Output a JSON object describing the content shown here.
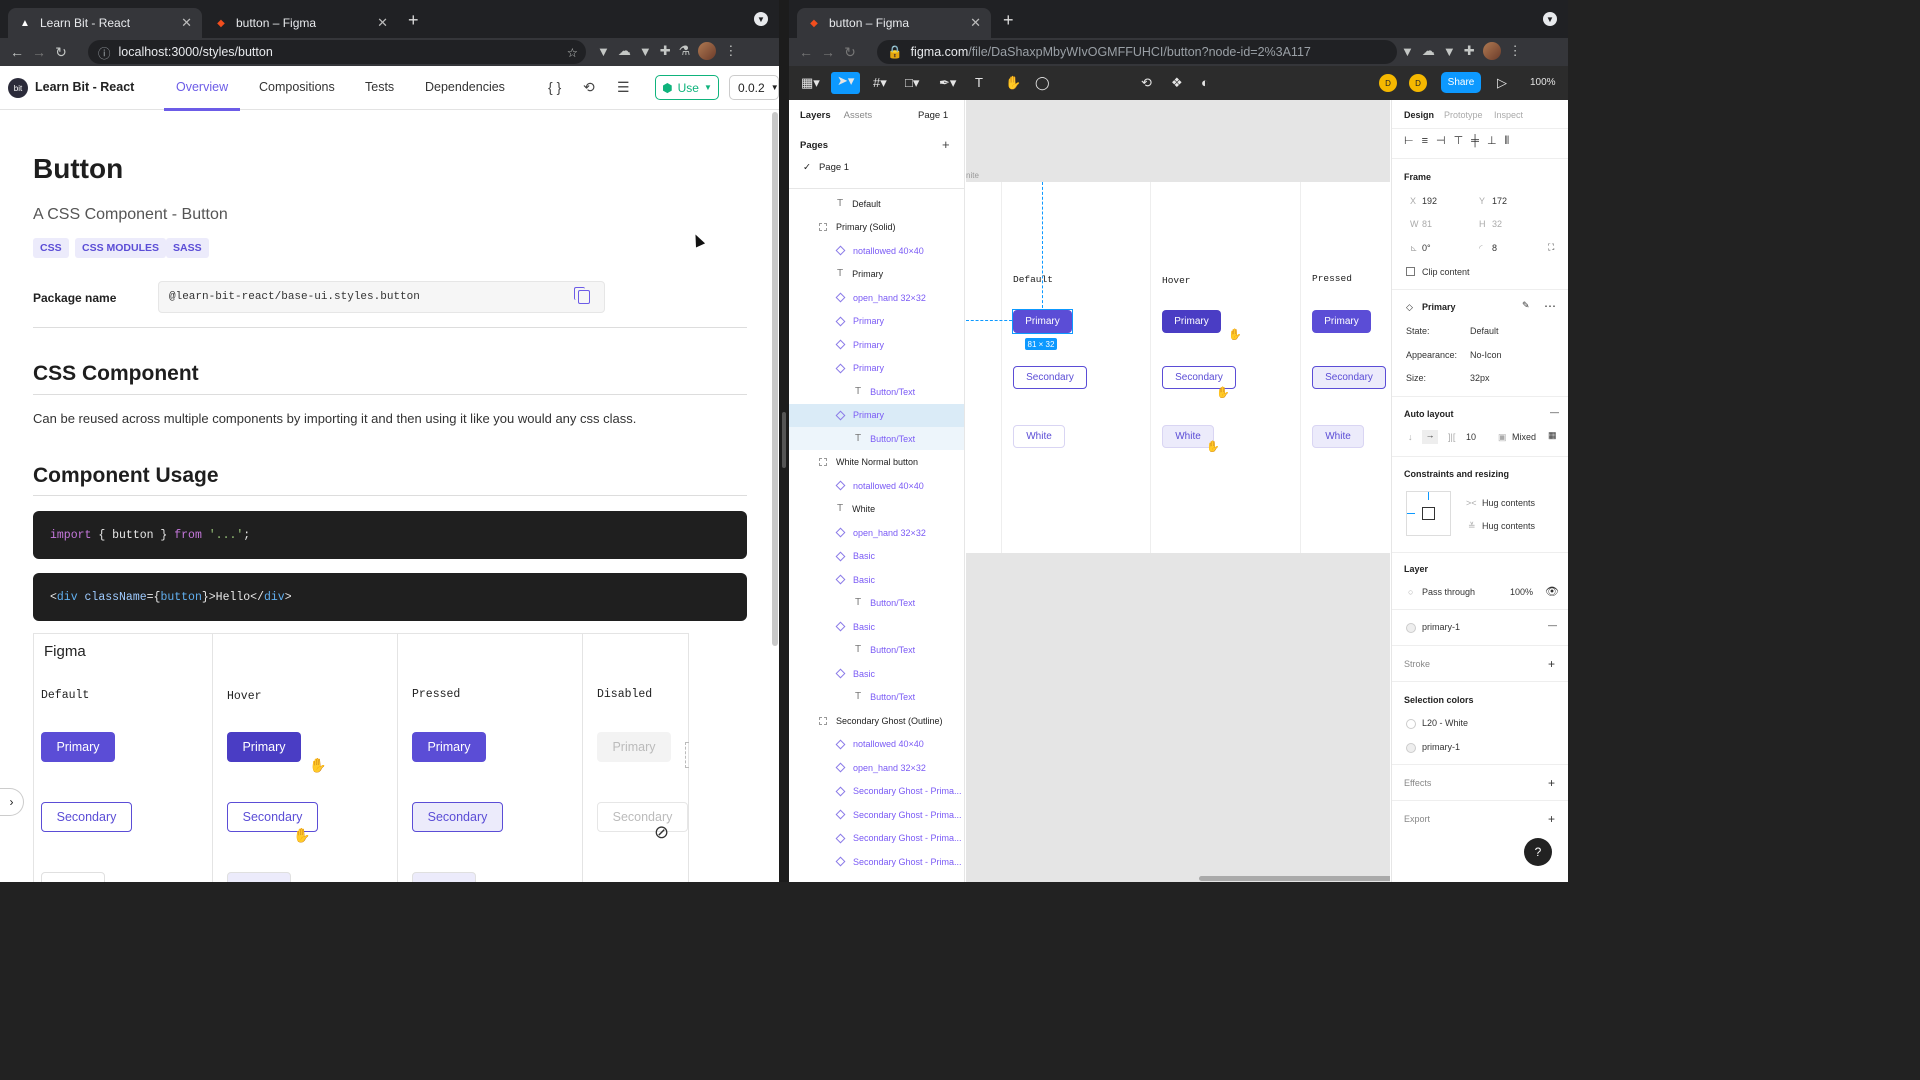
{
  "left_browser": {
    "tabs": [
      {
        "title": "Learn Bit - React",
        "active": true
      },
      {
        "title": "button – Figma",
        "active": false
      }
    ],
    "url": "localhost:3000/styles/button"
  },
  "right_browser": {
    "tabs": [
      {
        "title": "button – Figma",
        "active": true
      }
    ],
    "url_host": "figma.com",
    "url_path": "/file/DaShaxpMbyWIvOGMFFUHCI/button?node-id=2%3A117"
  },
  "bit": {
    "app_title": "Learn Bit - React",
    "logo": "bit",
    "nav_tabs": [
      "Overview",
      "Compositions",
      "Tests",
      "Dependencies"
    ],
    "use_label": "Use",
    "version": "0.0.2",
    "title": "Button",
    "subtitle": "A CSS Component -  Button",
    "tags": [
      "CSS",
      "CSS MODULES",
      "SASS"
    ],
    "package_label": "Package name",
    "package_name": "@learn-bit-react/base-ui.styles.button",
    "section1": "CSS Component",
    "section1_text": "Can be reused across multiple components by importing it and then using it like you would any css class.",
    "section2": "Component Usage",
    "code1": {
      "kw1": "import",
      "mid": " { button } ",
      "kw2": "from",
      "str": " '...'",
      "end": ";"
    },
    "code2": {
      "open": "<",
      "tag": "div",
      "attr": " className",
      "eq": "={",
      "val": "button",
      "mid": "}>Hello</",
      "tag2": "div",
      "close": ">"
    },
    "figma_label": "Figma",
    "states": [
      "Default",
      "Hover",
      "Pressed",
      "Disabled"
    ],
    "primary": "Primary",
    "secondary": "Secondary",
    "colors": {
      "accent": "#5b4dd6",
      "use_green": "#0fb37c"
    }
  },
  "figma": {
    "layer_tabs": [
      "Layers",
      "Assets"
    ],
    "page_select": "Page 1",
    "pages_heading": "Pages",
    "page_item": "Page 1",
    "layers": [
      {
        "name": "Default",
        "kind": "text",
        "indent": 2
      },
      {
        "name": "Primary (Solid)",
        "kind": "frame",
        "indent": 1
      },
      {
        "name": "notallowed 40×40",
        "kind": "instance",
        "indent": 2
      },
      {
        "name": "Primary",
        "kind": "text",
        "indent": 2
      },
      {
        "name": "open_hand 32×32",
        "kind": "instance",
        "indent": 2
      },
      {
        "name": "Primary",
        "kind": "instance",
        "indent": 2
      },
      {
        "name": "Primary",
        "kind": "instance",
        "indent": 2
      },
      {
        "name": "Primary",
        "kind": "instance",
        "indent": 2
      },
      {
        "name": "Button/Text",
        "kind": "text",
        "indent": 3
      },
      {
        "name": "Primary",
        "kind": "instance",
        "indent": 2,
        "selected": true
      },
      {
        "name": "Button/Text",
        "kind": "text",
        "indent": 3,
        "subselected": true
      },
      {
        "name": "White Normal button",
        "kind": "frame",
        "indent": 1
      },
      {
        "name": "notallowed 40×40",
        "kind": "instance",
        "indent": 2
      },
      {
        "name": "White",
        "kind": "text",
        "indent": 2
      },
      {
        "name": "open_hand 32×32",
        "kind": "instance",
        "indent": 2
      },
      {
        "name": "Basic",
        "kind": "instance",
        "indent": 2
      },
      {
        "name": "Basic",
        "kind": "instance",
        "indent": 2
      },
      {
        "name": "Button/Text",
        "kind": "text",
        "indent": 3
      },
      {
        "name": "Basic",
        "kind": "instance",
        "indent": 2
      },
      {
        "name": "Button/Text",
        "kind": "text",
        "indent": 3
      },
      {
        "name": "Basic",
        "kind": "instance",
        "indent": 2
      },
      {
        "name": "Button/Text",
        "kind": "text",
        "indent": 3
      },
      {
        "name": "Secondary Ghost (Outline)",
        "kind": "frame",
        "indent": 1
      },
      {
        "name": "notallowed 40×40",
        "kind": "instance",
        "indent": 2
      },
      {
        "name": "open_hand 32×32",
        "kind": "instance",
        "indent": 2
      },
      {
        "name": "Secondary Ghost - Prima...",
        "kind": "instance",
        "indent": 2
      },
      {
        "name": "Secondary Ghost - Prima...",
        "kind": "instance",
        "indent": 2
      },
      {
        "name": "Secondary Ghost - Prima...",
        "kind": "instance",
        "indent": 2
      },
      {
        "name": "Secondary Ghost - Prima...",
        "kind": "instance",
        "indent": 2
      }
    ],
    "canvas": {
      "frame_label_fragment": "nite",
      "heads": [
        "Default",
        "Hover",
        "Pressed"
      ],
      "primary": "Primary",
      "secondary": "Secondary",
      "white": "White",
      "dimension_tag": "81 × 32"
    },
    "zoom": "100%",
    "share": "Share",
    "props": {
      "tabs": [
        "Design",
        "Prototype",
        "Inspect"
      ],
      "frame_label": "Frame",
      "x": "192",
      "y": "172",
      "w": "81",
      "h": "32",
      "rotation": "0°",
      "radius": "8",
      "clip": "Clip content",
      "component": "Primary",
      "state_label": "State:",
      "state": "Default",
      "appearance_label": "Appearance:",
      "appearance": "No-Icon",
      "size_label": "Size:",
      "size": "32px",
      "auto_layout": "Auto layout",
      "spacing": "10",
      "padding": "Mixed",
      "constraints": "Constraints and resizing",
      "hug1": "Hug contents",
      "hug2": "Hug contents",
      "layer": "Layer",
      "blend": "Pass through",
      "opacity": "100%",
      "fill_name": "primary-1",
      "stroke": "Stroke",
      "selection_colors": "Selection colors",
      "sc1": "L20 - White",
      "sc2": "primary-1",
      "effects": "Effects",
      "export": "Export",
      "help": "?"
    },
    "colors": {
      "blue": "#0d99ff",
      "dark": "#2c2c2c"
    }
  }
}
